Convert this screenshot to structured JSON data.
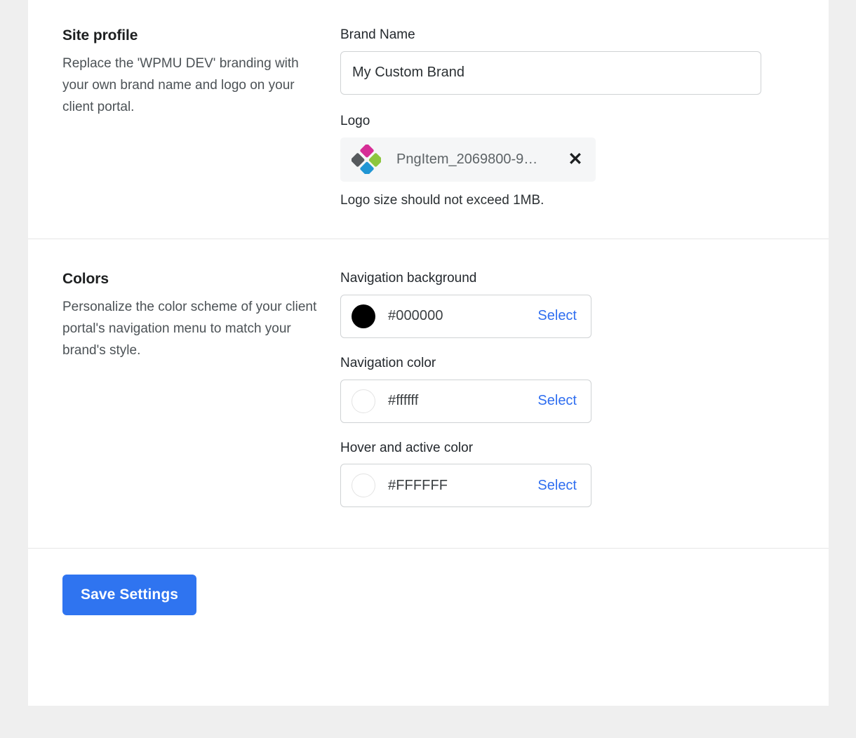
{
  "page": {
    "background_color": "#efefef",
    "card_background": "#ffffff"
  },
  "site_profile": {
    "title": "Site profile",
    "description": "Replace the 'WPMU DEV' branding with your own brand name and logo on your client portal.",
    "brand_name": {
      "label": "Brand Name",
      "value": "My Custom Brand",
      "placeholder": "Brand Name"
    },
    "logo": {
      "label": "Logo",
      "filename": "PngItem_2069800-9…",
      "remove_icon": "close-icon",
      "remove_glyph": "✕",
      "thumbnail_icon": "diamond-logo-icon",
      "thumbnail_colors": {
        "top": "#d62d96",
        "left": "#565a5d",
        "right": "#8cc63e",
        "bottom": "#2196d4"
      },
      "hint": "Logo size should not exceed 1MB."
    }
  },
  "colors": {
    "title": "Colors",
    "description": "Personalize the color scheme of your client portal's navigation menu to match your brand's style.",
    "select_label": "Select",
    "select_link_color": "#2f6ef0",
    "fields": [
      {
        "label": "Navigation background",
        "value": "#000000",
        "swatch_color": "#000000",
        "swatch_bordered": false
      },
      {
        "label": "Navigation color",
        "value": "#ffffff",
        "swatch_color": "#ffffff",
        "swatch_bordered": true
      },
      {
        "label": "Hover and active color",
        "value": "#FFFFFF",
        "swatch_color": "#ffffff",
        "swatch_bordered": true
      }
    ]
  },
  "footer": {
    "save_label": "Save Settings",
    "save_color": "#2f74f0"
  }
}
